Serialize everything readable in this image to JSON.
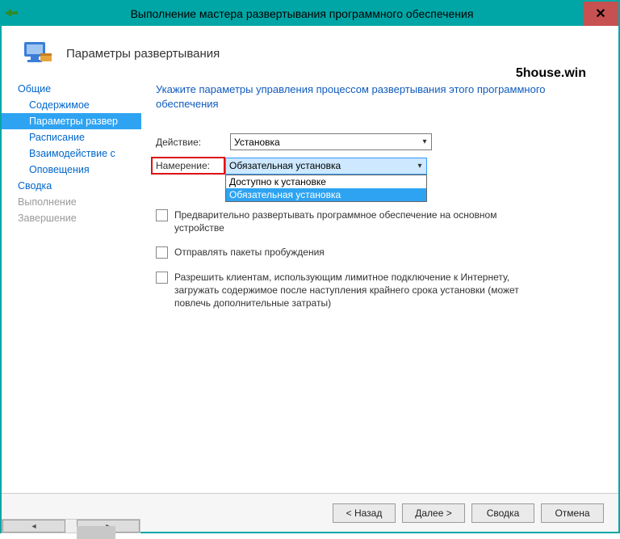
{
  "titlebar": {
    "title": "Выполнение мастера развертывания программного обеспечения"
  },
  "header": {
    "page_title": "Параметры развертывания"
  },
  "watermark": "5house.win",
  "sidebar": {
    "items": [
      {
        "label": "Общие",
        "child": false,
        "selected": false,
        "disabled": false
      },
      {
        "label": "Содержимое",
        "child": true,
        "selected": false,
        "disabled": false
      },
      {
        "label": "Параметры развер",
        "child": true,
        "selected": true,
        "disabled": false
      },
      {
        "label": "Расписание",
        "child": true,
        "selected": false,
        "disabled": false
      },
      {
        "label": "Взаимодействие с",
        "child": true,
        "selected": false,
        "disabled": false
      },
      {
        "label": "Оповещения",
        "child": true,
        "selected": false,
        "disabled": false
      },
      {
        "label": "Сводка",
        "child": false,
        "selected": false,
        "disabled": false
      },
      {
        "label": "Выполнение",
        "child": false,
        "selected": false,
        "disabled": true
      },
      {
        "label": "Завершение",
        "child": false,
        "selected": false,
        "disabled": true
      }
    ]
  },
  "content": {
    "instruction": "Укажите параметры управления процессом развертывания этого программного обеспечения",
    "action_label": "Действие:",
    "action_value": "Установка",
    "purpose_label": "Намерение:",
    "purpose_value": "Обязательная установка",
    "purpose_options": [
      "Доступно к установке",
      "Обязательная установка"
    ],
    "checks": [
      "Предварительно развертывать программное обеспечение на основном устройстве",
      "Отправлять пакеты пробуждения",
      "Разрешить клиентам, использующим лимитное подключение к Интернету, загружать содержимое после наступления крайнего срока установки (может повлечь дополнительные затраты)"
    ]
  },
  "footer": {
    "back": "< Назад",
    "next": "Далее >",
    "summary": "Сводка",
    "cancel": "Отмена"
  }
}
